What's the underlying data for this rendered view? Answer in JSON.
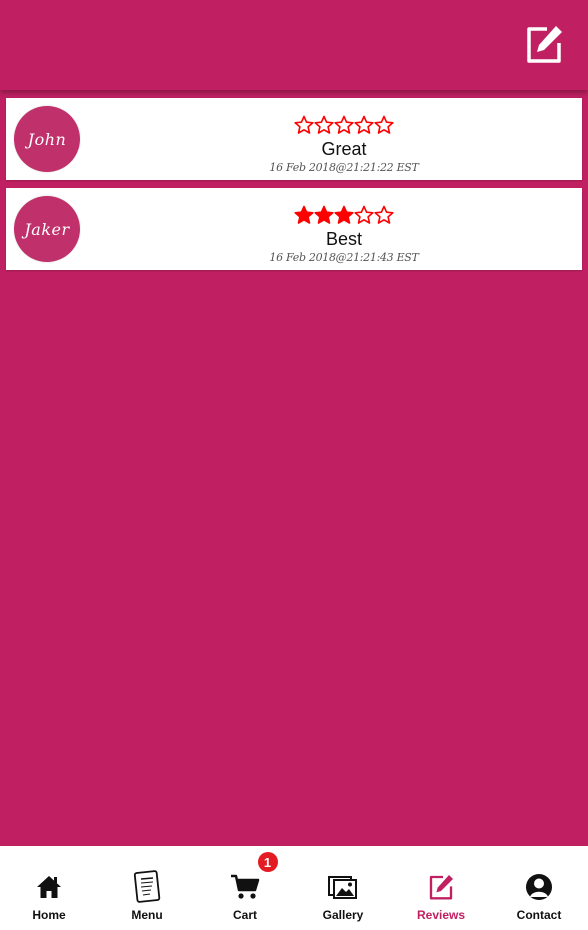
{
  "colors": {
    "brand": "#c02062",
    "star": "#ff0000",
    "badge": "#e51b24"
  },
  "header": {
    "compose_icon": "edit-icon"
  },
  "reviews": [
    {
      "avatar_name": "John",
      "rating": 0,
      "max_rating": 5,
      "text": "Great",
      "date": "16 Feb 2018@21:21:22 EST"
    },
    {
      "avatar_name": "Jaker",
      "rating": 3,
      "max_rating": 5,
      "text": "Best",
      "date": "16 Feb 2018@21:21:43 EST"
    }
  ],
  "nav": {
    "items": [
      {
        "label": "Home",
        "icon": "home-icon"
      },
      {
        "label": "Menu",
        "icon": "menu-book-icon"
      },
      {
        "label": "Cart",
        "icon": "cart-icon",
        "badge": "1"
      },
      {
        "label": "Gallery",
        "icon": "gallery-icon"
      },
      {
        "label": "Reviews",
        "icon": "edit-icon",
        "active": true
      },
      {
        "label": "Contact",
        "icon": "person-icon"
      }
    ]
  }
}
